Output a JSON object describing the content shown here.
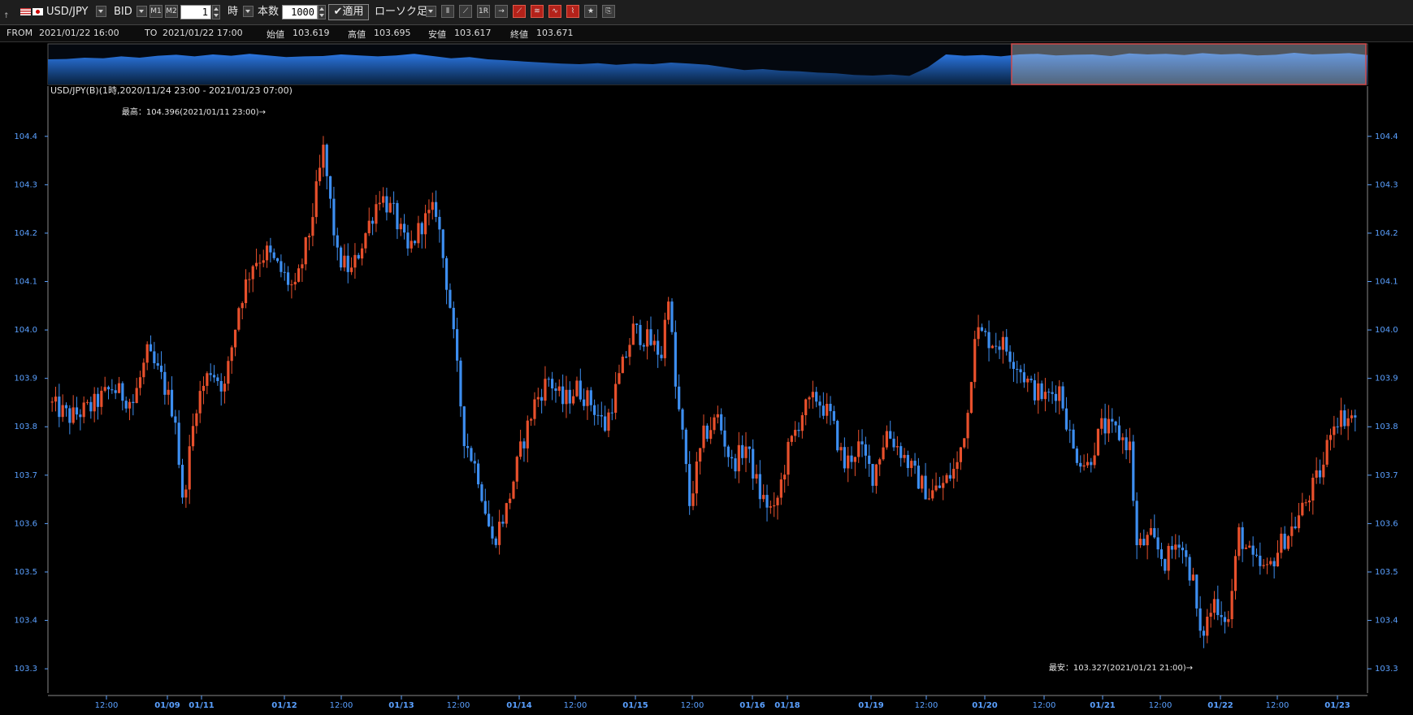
{
  "toolbar": {
    "symbol": "USD/JPY",
    "side": "BID",
    "period_value": "1",
    "period_unit": "時",
    "count_label": "本数",
    "count_value": "1000",
    "apply_label": "適用",
    "chart_type_label": "ローソク足",
    "icons": [
      "flag-us-icon",
      "flag-jp-icon",
      "m1-icon",
      "m2-icon",
      "candle-type-icon",
      "line-type-icon",
      "1r-icon",
      "arrow-icon",
      "trend-icon",
      "band-icon",
      "oscillator-icon",
      "wave-icon",
      "star-icon",
      "export-icon"
    ]
  },
  "info": {
    "from_label": "FROM",
    "from_value": "2021/01/22 16:00",
    "to_label": "TO",
    "to_value": "2021/01/22 17:00",
    "open_label": "始値",
    "open_value": "103.619",
    "high_label": "高値",
    "high_value": "103.695",
    "low_label": "安値",
    "low_value": "103.617",
    "close_label": "終値",
    "close_value": "103.671"
  },
  "chart_data": {
    "type": "candlestick",
    "title": "USD/JPY(B)(1時,2020/11/24 23:00 - 2021/01/23 07:00)",
    "ylim": [
      103.27,
      104.45
    ],
    "yticks": [
      "104.4",
      "104.3",
      "104.2",
      "104.1",
      "104.0",
      "103.9",
      "103.8",
      "103.7",
      "103.6",
      "103.5",
      "103.4",
      "103.3"
    ],
    "xtick_labels": [
      "12:00",
      "01/09",
      "01/11",
      "01/12",
      "12:00",
      "01/13",
      "12:00",
      "01/14",
      "12:00",
      "01/15",
      "12:00",
      "01/16",
      "01/18",
      "01/19",
      "12:00",
      "01/20",
      "12:00",
      "01/21",
      "12:00",
      "01/22",
      "12:00",
      "01/23"
    ],
    "high_annotation": "最高：104.396(2021/01/11 23:00)→",
    "low_annotation": "最安：103.327(2021/01/21 21:00)→",
    "anchors": [
      [
        0,
        103.85
      ],
      [
        6,
        103.82
      ],
      [
        12,
        103.84
      ],
      [
        18,
        103.88
      ],
      [
        24,
        103.85
      ],
      [
        28,
        103.95
      ],
      [
        32,
        103.9
      ],
      [
        36,
        103.82
      ],
      [
        38,
        103.64
      ],
      [
        42,
        103.85
      ],
      [
        46,
        103.92
      ],
      [
        50,
        103.88
      ],
      [
        54,
        104.05
      ],
      [
        58,
        104.14
      ],
      [
        62,
        104.16
      ],
      [
        66,
        104.12
      ],
      [
        70,
        104.08
      ],
      [
        74,
        104.2
      ],
      [
        78,
        104.37
      ],
      [
        82,
        104.15
      ],
      [
        86,
        104.12
      ],
      [
        90,
        104.2
      ],
      [
        94,
        104.28
      ],
      [
        98,
        104.24
      ],
      [
        102,
        104.16
      ],
      [
        106,
        104.22
      ],
      [
        110,
        104.25
      ],
      [
        114,
        104.05
      ],
      [
        118,
        103.78
      ],
      [
        122,
        103.7
      ],
      [
        126,
        103.56
      ],
      [
        130,
        103.63
      ],
      [
        134,
        103.75
      ],
      [
        138,
        103.85
      ],
      [
        142,
        103.9
      ],
      [
        146,
        103.85
      ],
      [
        150,
        103.88
      ],
      [
        154,
        103.85
      ],
      [
        158,
        103.8
      ],
      [
        162,
        103.9
      ],
      [
        166,
        104.0
      ],
      [
        170,
        103.98
      ],
      [
        174,
        103.95
      ],
      [
        176,
        104.08
      ],
      [
        178,
        103.88
      ],
      [
        180,
        103.78
      ],
      [
        182,
        103.64
      ],
      [
        186,
        103.78
      ],
      [
        190,
        103.82
      ],
      [
        194,
        103.72
      ],
      [
        198,
        103.76
      ],
      [
        202,
        103.66
      ],
      [
        206,
        103.62
      ],
      [
        210,
        103.75
      ],
      [
        214,
        103.83
      ],
      [
        218,
        103.86
      ],
      [
        222,
        103.82
      ],
      [
        226,
        103.72
      ],
      [
        230,
        103.76
      ],
      [
        234,
        103.7
      ],
      [
        238,
        103.79
      ],
      [
        242,
        103.75
      ],
      [
        246,
        103.7
      ],
      [
        250,
        103.66
      ],
      [
        254,
        103.68
      ],
      [
        258,
        103.72
      ],
      [
        261,
        103.83
      ],
      [
        263,
        104.0
      ],
      [
        267,
        103.98
      ],
      [
        271,
        103.97
      ],
      [
        275,
        103.93
      ],
      [
        279,
        103.88
      ],
      [
        283,
        103.86
      ],
      [
        287,
        103.88
      ],
      [
        291,
        103.75
      ],
      [
        295,
        103.72
      ],
      [
        299,
        103.8
      ],
      [
        303,
        103.79
      ],
      [
        307,
        103.76
      ],
      [
        309,
        103.55
      ],
      [
        313,
        103.57
      ],
      [
        317,
        103.52
      ],
      [
        321,
        103.57
      ],
      [
        325,
        103.48
      ],
      [
        327,
        103.36
      ],
      [
        331,
        103.44
      ],
      [
        335,
        103.4
      ],
      [
        338,
        103.58
      ],
      [
        342,
        103.52
      ],
      [
        346,
        103.5
      ],
      [
        350,
        103.56
      ],
      [
        354,
        103.6
      ],
      [
        358,
        103.66
      ],
      [
        362,
        103.72
      ],
      [
        364,
        103.8
      ],
      [
        366,
        103.82
      ],
      [
        370,
        103.82
      ]
    ]
  }
}
